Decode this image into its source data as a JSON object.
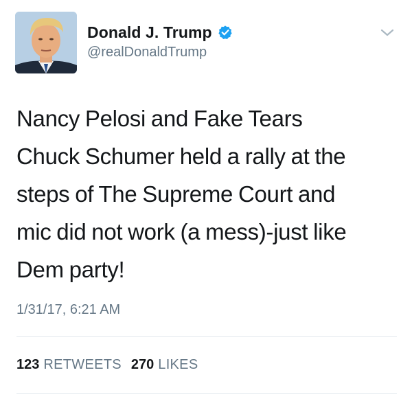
{
  "user": {
    "display_name": "Donald J. Trump",
    "handle": "@realDonaldTrump",
    "verified": true,
    "verified_color": "#1da1f2"
  },
  "tweet": {
    "text": "Nancy Pelosi and Fake Tears\nChuck Schumer held a rally  at the\nsteps of The Supreme Court and\nmic did not work (a mess)-just like\nDem party!",
    "timestamp": "1/31/17, 6:21 AM"
  },
  "stats": {
    "retweets_count": "123",
    "retweets_label": "RETWEETS",
    "likes_count": "270",
    "likes_label": "LIKES"
  },
  "icons": {
    "menu": "chevron-down-icon",
    "verified": "verified-badge-icon"
  },
  "colors": {
    "text_primary": "#14171a",
    "text_secondary": "#657786",
    "divider": "#e1e8ed"
  }
}
